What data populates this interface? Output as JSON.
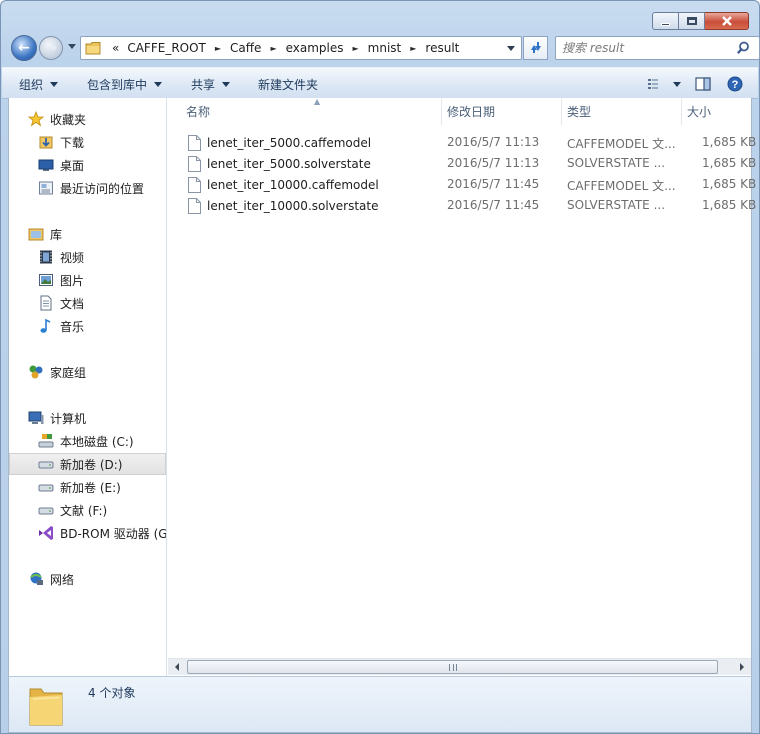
{
  "address": {
    "overflow_label": "«",
    "crumbs": [
      "CAFFE_ROOT",
      "Caffe",
      "examples",
      "mnist",
      "result"
    ]
  },
  "search": {
    "placeholder": "搜索 result"
  },
  "toolbar": {
    "organize": "组织",
    "include_in_library": "包含到库中",
    "share": "共享",
    "new_folder": "新建文件夹"
  },
  "nav": {
    "favorites": "收藏夹",
    "downloads": "下载",
    "desktop": "桌面",
    "recent": "最近访问的位置",
    "libraries": "库",
    "videos": "视频",
    "pictures": "图片",
    "documents": "文档",
    "music": "音乐",
    "homegroup": "家庭组",
    "computer": "计算机",
    "drive_c": "本地磁盘 (C:)",
    "drive_d": "新加卷 (D:)",
    "drive_e": "新加卷 (E:)",
    "drive_f": "文献 (F:)",
    "drive_bd": "BD-ROM 驱动器 (G",
    "network": "网络"
  },
  "columns": {
    "name": "名称",
    "date": "修改日期",
    "type": "类型",
    "size": "大小"
  },
  "files": [
    {
      "name": "lenet_iter_5000.caffemodel",
      "date": "2016/5/7 11:13",
      "type": "CAFFEMODEL 文...",
      "size": "1,685 KB"
    },
    {
      "name": "lenet_iter_5000.solverstate",
      "date": "2016/5/7 11:13",
      "type": "SOLVERSTATE ...",
      "size": "1,685 KB"
    },
    {
      "name": "lenet_iter_10000.caffemodel",
      "date": "2016/5/7 11:45",
      "type": "CAFFEMODEL 文...",
      "size": "1,685 KB"
    },
    {
      "name": "lenet_iter_10000.solverstate",
      "date": "2016/5/7 11:45",
      "type": "SOLVERSTATE ...",
      "size": "1,685 KB"
    }
  ],
  "details": {
    "count": "4 个对象"
  },
  "colors": {
    "accent": "#1e395b",
    "selection": "#e5e5e5",
    "folder": "#f2cf6b"
  },
  "icons": {
    "back": "back-arrow-icon",
    "forward": "forward-arrow-icon",
    "refresh": "refresh-icon",
    "search": "search-icon",
    "file": "blank-file-icon",
    "folder": "folder-icon"
  }
}
